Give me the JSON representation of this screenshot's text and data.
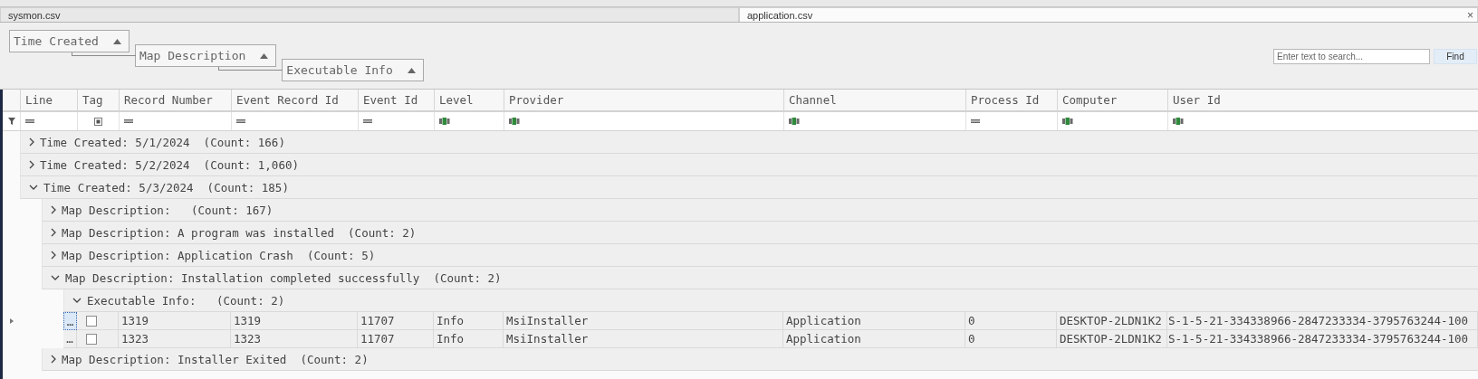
{
  "tabs": [
    {
      "label": "sysmon.csv",
      "selected": false
    },
    {
      "label": "application.csv",
      "selected": true,
      "close": "×"
    }
  ],
  "group_panel": [
    {
      "label": "Time Created"
    },
    {
      "label": "Map Description"
    },
    {
      "label": "Executable Info"
    }
  ],
  "search": {
    "placeholder": "Enter text to search...",
    "button": "Find"
  },
  "grid": {
    "columns": [
      {
        "label": "Line",
        "kind": "menu",
        "filter": {
          "kind": "equals"
        }
      },
      {
        "label": "Tag",
        "kind": "check",
        "filter": {
          "kind": "check"
        }
      },
      {
        "label": "Record Number",
        "kind": "number",
        "filter": {
          "kind": "equals"
        }
      },
      {
        "label": "Event Record Id",
        "kind": "number",
        "filter": {
          "kind": "equals"
        }
      },
      {
        "label": "Event Id",
        "kind": "number",
        "filter": {
          "kind": "equals"
        }
      },
      {
        "label": "Level",
        "kind": "text",
        "filter": {
          "kind": "text"
        }
      },
      {
        "label": "Provider",
        "kind": "text",
        "filter": {
          "kind": "text"
        }
      },
      {
        "label": "Channel",
        "kind": "text",
        "filter": {
          "kind": "text"
        }
      },
      {
        "label": "Process Id",
        "kind": "number",
        "filter": {
          "kind": "equals"
        }
      },
      {
        "label": "Computer",
        "kind": "text",
        "filter": {
          "kind": "text"
        }
      },
      {
        "label": "User Id",
        "kind": "text",
        "filter": {
          "kind": "text"
        }
      }
    ],
    "groups": [
      {
        "label": "Time Created: 5/1/2024  (Count: 166)",
        "expanded": false
      },
      {
        "label": "Time Created: 5/2/2024  (Count: 1,060)",
        "expanded": false
      },
      {
        "label": "Time Created: 5/3/2024  (Count: 185)",
        "expanded": true,
        "children": [
          {
            "label": "Map Description:   (Count: 167)",
            "expanded": false
          },
          {
            "label": "Map Description: A program was installed  (Count: 2)",
            "expanded": false
          },
          {
            "label": "Map Description: Application Crash  (Count: 5)",
            "expanded": false
          },
          {
            "label": "Map Description: Installation completed successfully  (Count: 2)",
            "expanded": true,
            "children": [
              {
                "label": "Executable Info:   (Count: 2)",
                "expanded": true,
                "rows": [
                  {
                    "current": true,
                    "focused": true,
                    "cells": [
                      "…",
                      false,
                      "1319",
                      "1319",
                      "11707",
                      "Info",
                      "MsiInstaller",
                      "Application",
                      "0",
                      "DESKTOP-2LDN1K2",
                      "S-1-5-21-334338966-2847233334-3795763244-100"
                    ]
                  },
                  {
                    "current": false,
                    "focused": false,
                    "cells": [
                      "…",
                      false,
                      "1323",
                      "1323",
                      "11707",
                      "Info",
                      "MsiInstaller",
                      "Application",
                      "0",
                      "DESKTOP-2LDN1K2",
                      "S-1-5-21-334338966-2847233334-3795763244-100"
                    ]
                  }
                ]
              }
            ]
          },
          {
            "label": "Map Description: Installer Exited  (Count: 2)",
            "expanded": false
          }
        ]
      }
    ]
  }
}
